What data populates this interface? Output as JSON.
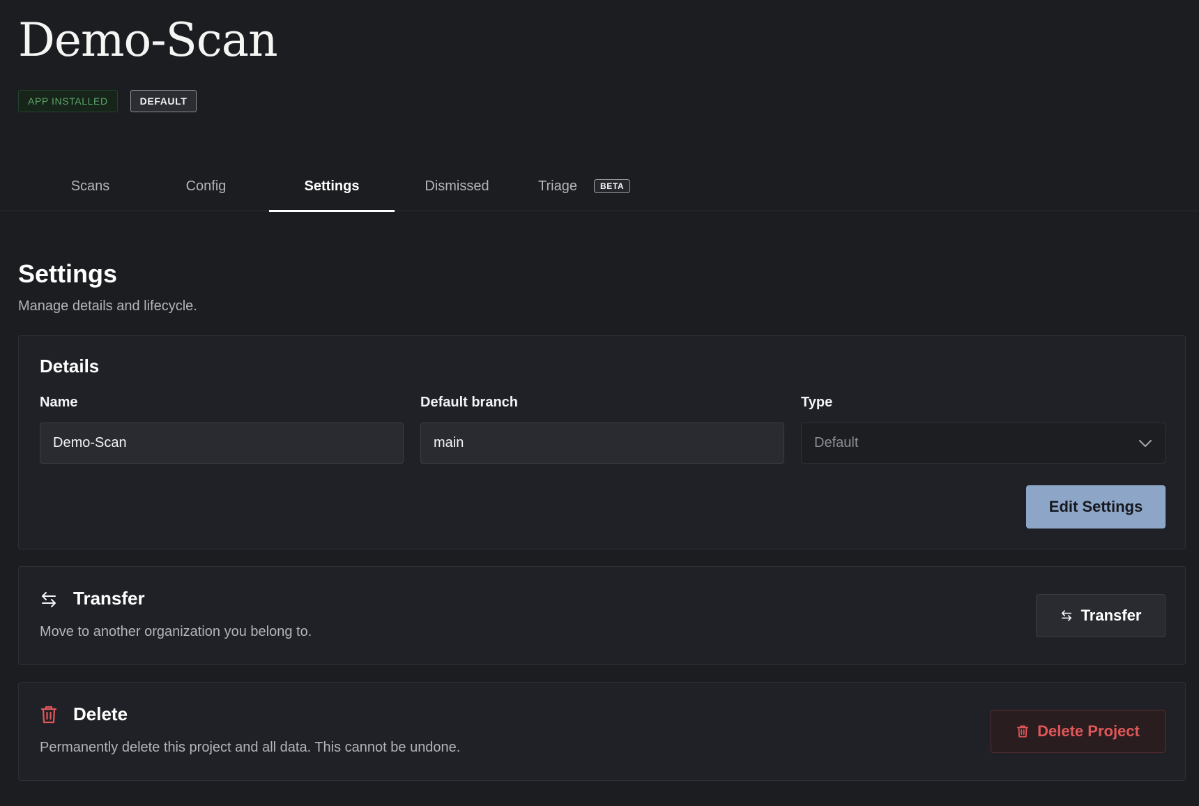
{
  "project": {
    "title": "Demo-Scan",
    "badges": {
      "installed": "APP INSTALLED",
      "default": "DEFAULT"
    }
  },
  "tabs": [
    {
      "label": "Scans"
    },
    {
      "label": "Config"
    },
    {
      "label": "Settings",
      "active": true
    },
    {
      "label": "Dismissed"
    },
    {
      "label": "Triage",
      "badge": "BETA"
    }
  ],
  "settings": {
    "title": "Settings",
    "subtitle": "Manage details and lifecycle."
  },
  "details": {
    "heading": "Details",
    "name_label": "Name",
    "name_value": "Demo-Scan",
    "branch_label": "Default branch",
    "branch_value": "main",
    "type_label": "Type",
    "type_value": "Default",
    "edit_button": "Edit Settings"
  },
  "transfer": {
    "heading": "Transfer",
    "description": "Move to another organization you belong to.",
    "button": "Transfer",
    "icon": "transfer-arrows-icon"
  },
  "delete": {
    "heading": "Delete",
    "description": "Permanently delete this project and all data. This cannot be undone.",
    "button": "Delete Project",
    "icon": "trash-icon",
    "color": "#e0575a"
  },
  "colors": {
    "background": "#1c1d21",
    "card": "#202126",
    "accent": "#8da6c8",
    "danger": "#e0575a",
    "success": "#5ea66b"
  }
}
